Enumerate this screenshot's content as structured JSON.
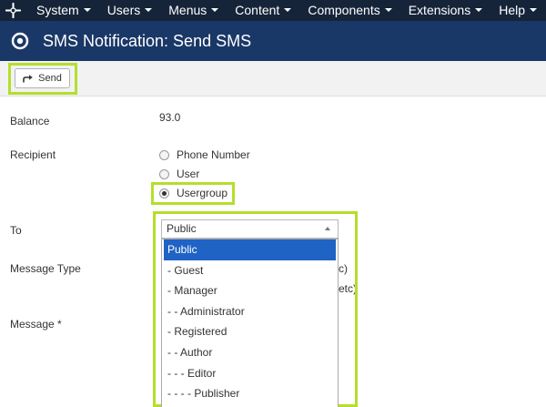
{
  "menu": {
    "items": [
      {
        "label": "System"
      },
      {
        "label": "Users"
      },
      {
        "label": "Menus"
      },
      {
        "label": "Content"
      },
      {
        "label": "Components"
      },
      {
        "label": "Extensions"
      },
      {
        "label": "Help"
      }
    ]
  },
  "page": {
    "title": "SMS Notification: Send SMS"
  },
  "toolbar": {
    "send_label": "Send"
  },
  "form": {
    "balance_label": "Balance",
    "balance_value": "93.0",
    "recipient_label": "Recipient",
    "recipient_options": [
      {
        "label": "Phone Number",
        "checked": false
      },
      {
        "label": "User",
        "checked": false
      },
      {
        "label": "Usergroup",
        "checked": true
      }
    ],
    "to_label": "To",
    "to_selected": "Public",
    "to_options": [
      "Public",
      "- Guest",
      "- Manager",
      "- - Administrator",
      "- Registered",
      "- - Author",
      "- - - Editor",
      "- - - - Publisher"
    ],
    "message_type_label": "Message Type",
    "message_type_partial_1": "c)",
    "message_type_partial_2": "etc)",
    "message_label": "Message *"
  },
  "colors": {
    "topbar": "#16243a",
    "titlebar": "#1a3867",
    "highlight": "#b5de2c",
    "dropdown_active": "#1f63c4"
  }
}
